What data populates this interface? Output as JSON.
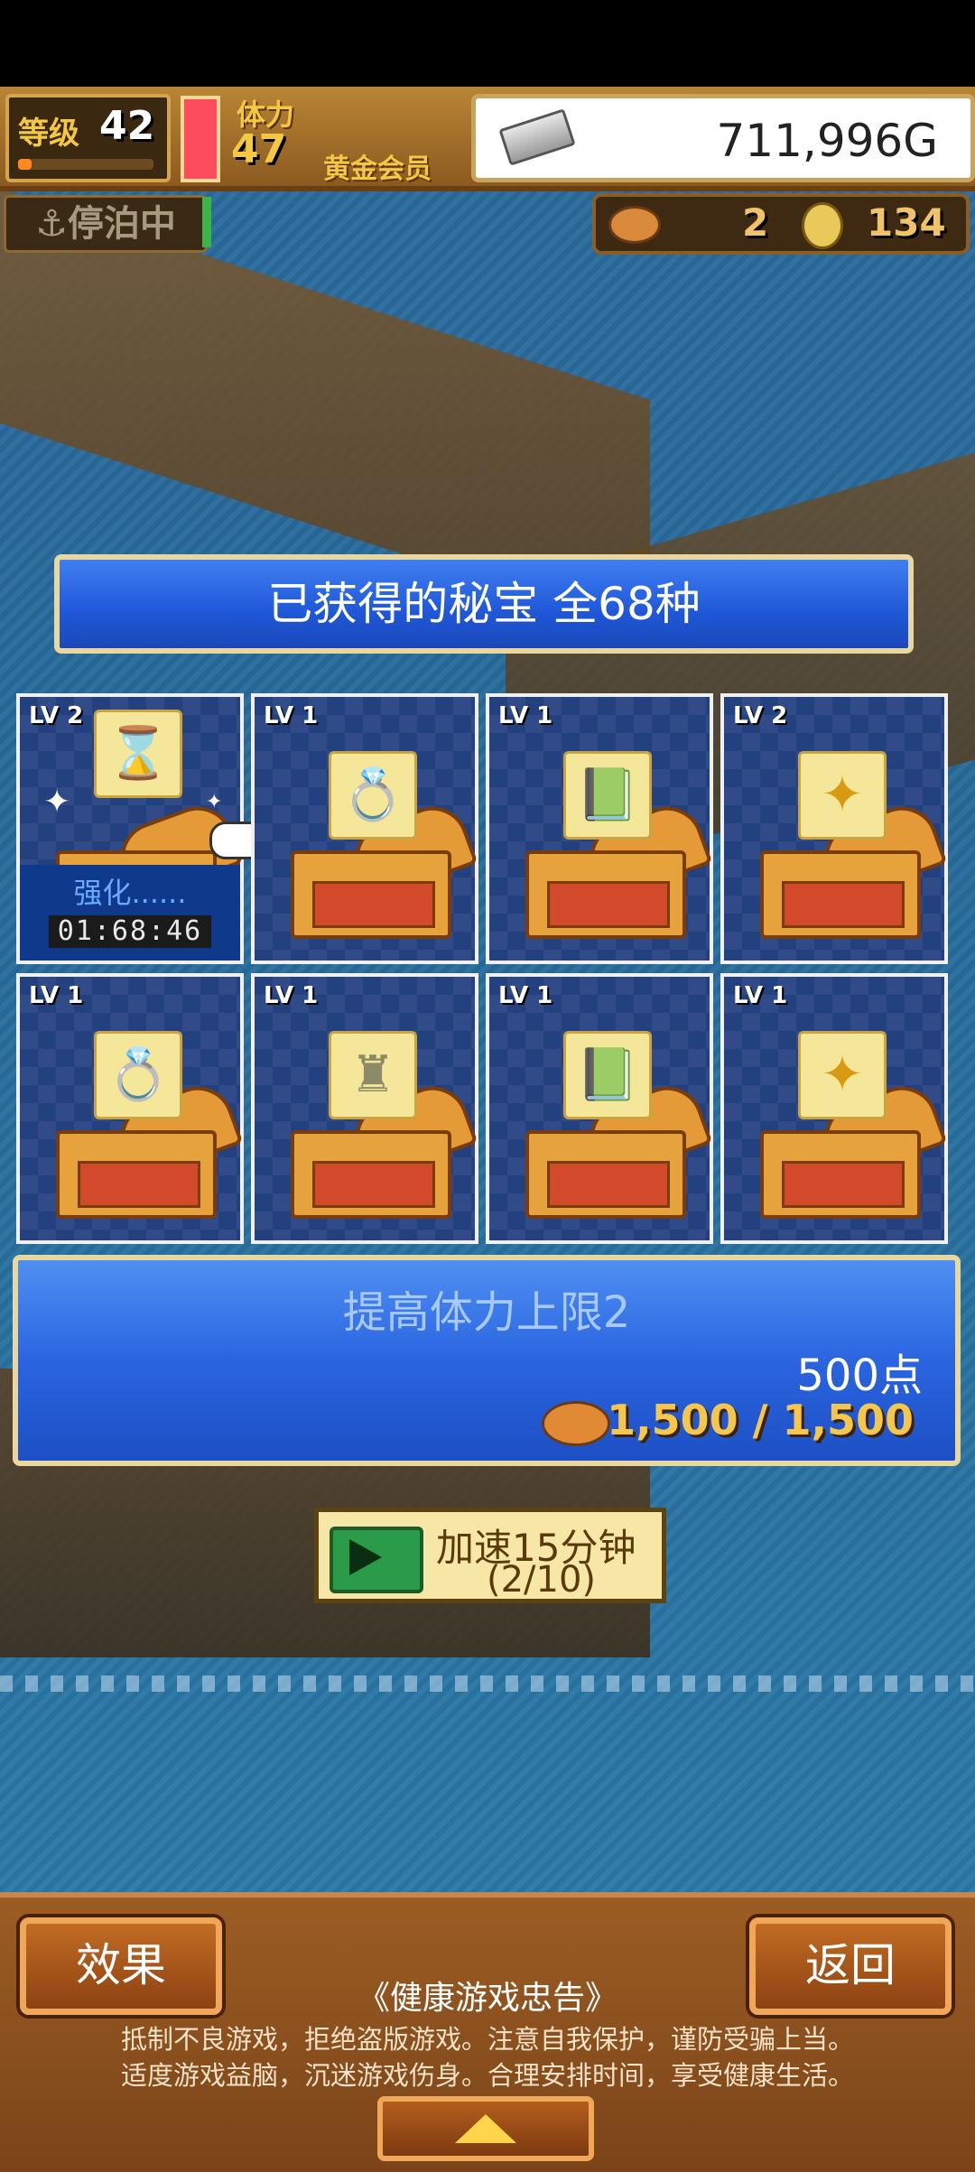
{
  "hud": {
    "level_label": "等级",
    "level_value": "42",
    "level_progress": 0.1,
    "stamina_label": "体力",
    "stamina_value": "47",
    "stamina_fill": 1.0,
    "membership": "黄金会员",
    "gold_value": "711,996G",
    "gold_icon": "silver-bar-icon"
  },
  "status": {
    "moored_label": "停泊中",
    "resource_1_icon": "meat-icon",
    "resource_1_value": "2",
    "resource_2_icon": "medal-icon",
    "resource_2_value": "134"
  },
  "title": "已获得的秘宝 全68种",
  "treasures": [
    {
      "level": "LV 2",
      "icon": "hourglass-icon",
      "glyph": "⌛",
      "enhancing": true,
      "enhance_label": "强化......",
      "timer": "01:68:46"
    },
    {
      "level": "LV 1",
      "icon": "ring-icon",
      "glyph": "💍"
    },
    {
      "level": "LV 1",
      "icon": "green-book-icon",
      "glyph": "📗"
    },
    {
      "level": "LV 2",
      "icon": "golden-gem-icon",
      "glyph": "✦"
    },
    {
      "level": "LV 1",
      "icon": "ring-icon",
      "glyph": "💍"
    },
    {
      "level": "LV 1",
      "icon": "statue-icon",
      "glyph": "♜"
    },
    {
      "level": "LV 1",
      "icon": "green-book-icon",
      "glyph": "📗"
    },
    {
      "level": "LV 1",
      "icon": "golden-gem-icon",
      "glyph": "✦"
    }
  ],
  "info": {
    "effect": "提高体力上限2",
    "points": "500点",
    "cost_icon": "meat-icon",
    "cost": "1,500 / 1,500"
  },
  "speedup": {
    "icon": "tv-play-icon",
    "line1": "加速15分钟",
    "line2": "(2/10)"
  },
  "bottom": {
    "effect_button": "效果",
    "back_button": "返回",
    "notice_title": "《健康游戏忠告》",
    "notice_line1": "抵制不良游戏，拒绝盗版游戏。注意自我保护，谨防受骗上当。",
    "notice_line2": "适度游戏益脑，沉迷游戏伤身。合理安排时间，享受健康生活。"
  }
}
